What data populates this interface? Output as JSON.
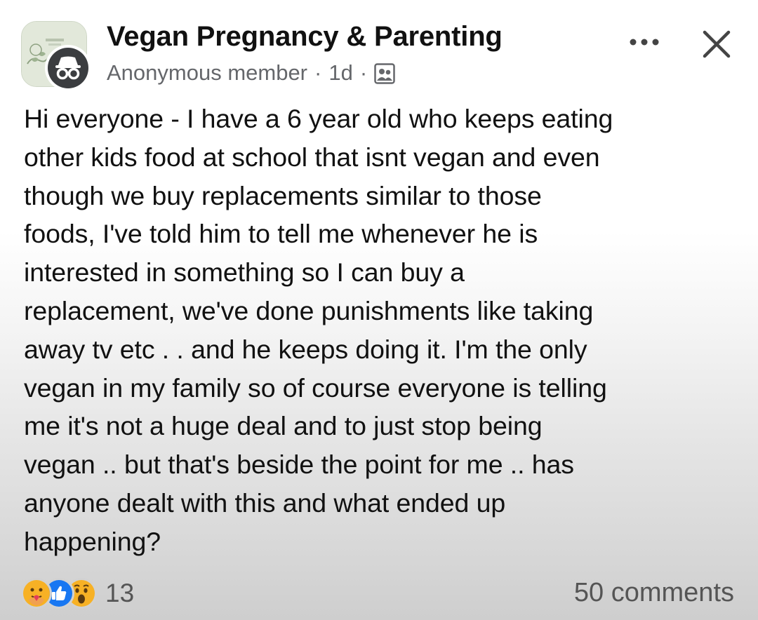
{
  "post": {
    "group_name": "Vegan Pregnancy & Parenting",
    "author": "Anonymous member",
    "separator": "·",
    "time_ago": "1d",
    "audience_icon": "group-members-icon",
    "more_icon": "more-options-icon",
    "close_icon": "close-icon",
    "body": "Hi everyone - I have a 6 year old who keeps eating\nother kids food at school that isnt vegan and even\nthough we buy replacements similar to those\nfoods, I've told him to tell me whenever he is\ninterested in something so I can buy a\nreplacement, we've done punishments like taking\naway tv etc . . and he keeps doing it. I'm the only\nvegan in my family so of course everyone is telling\nme it's not a huge deal and to just stop being\nvegan .. but that's beside the point for me .. has\nanyone dealt with this and what ended up\nhappening?"
  },
  "footer": {
    "reactions": [
      "care-reaction-icon",
      "like-reaction-icon",
      "wow-reaction-icon"
    ],
    "reaction_count": "13",
    "comments_label": "50 comments"
  },
  "colors": {
    "text": "#111111",
    "meta_text": "#65676b",
    "like_blue": "#1877f2",
    "reaction_yellow": "#f7b125"
  }
}
